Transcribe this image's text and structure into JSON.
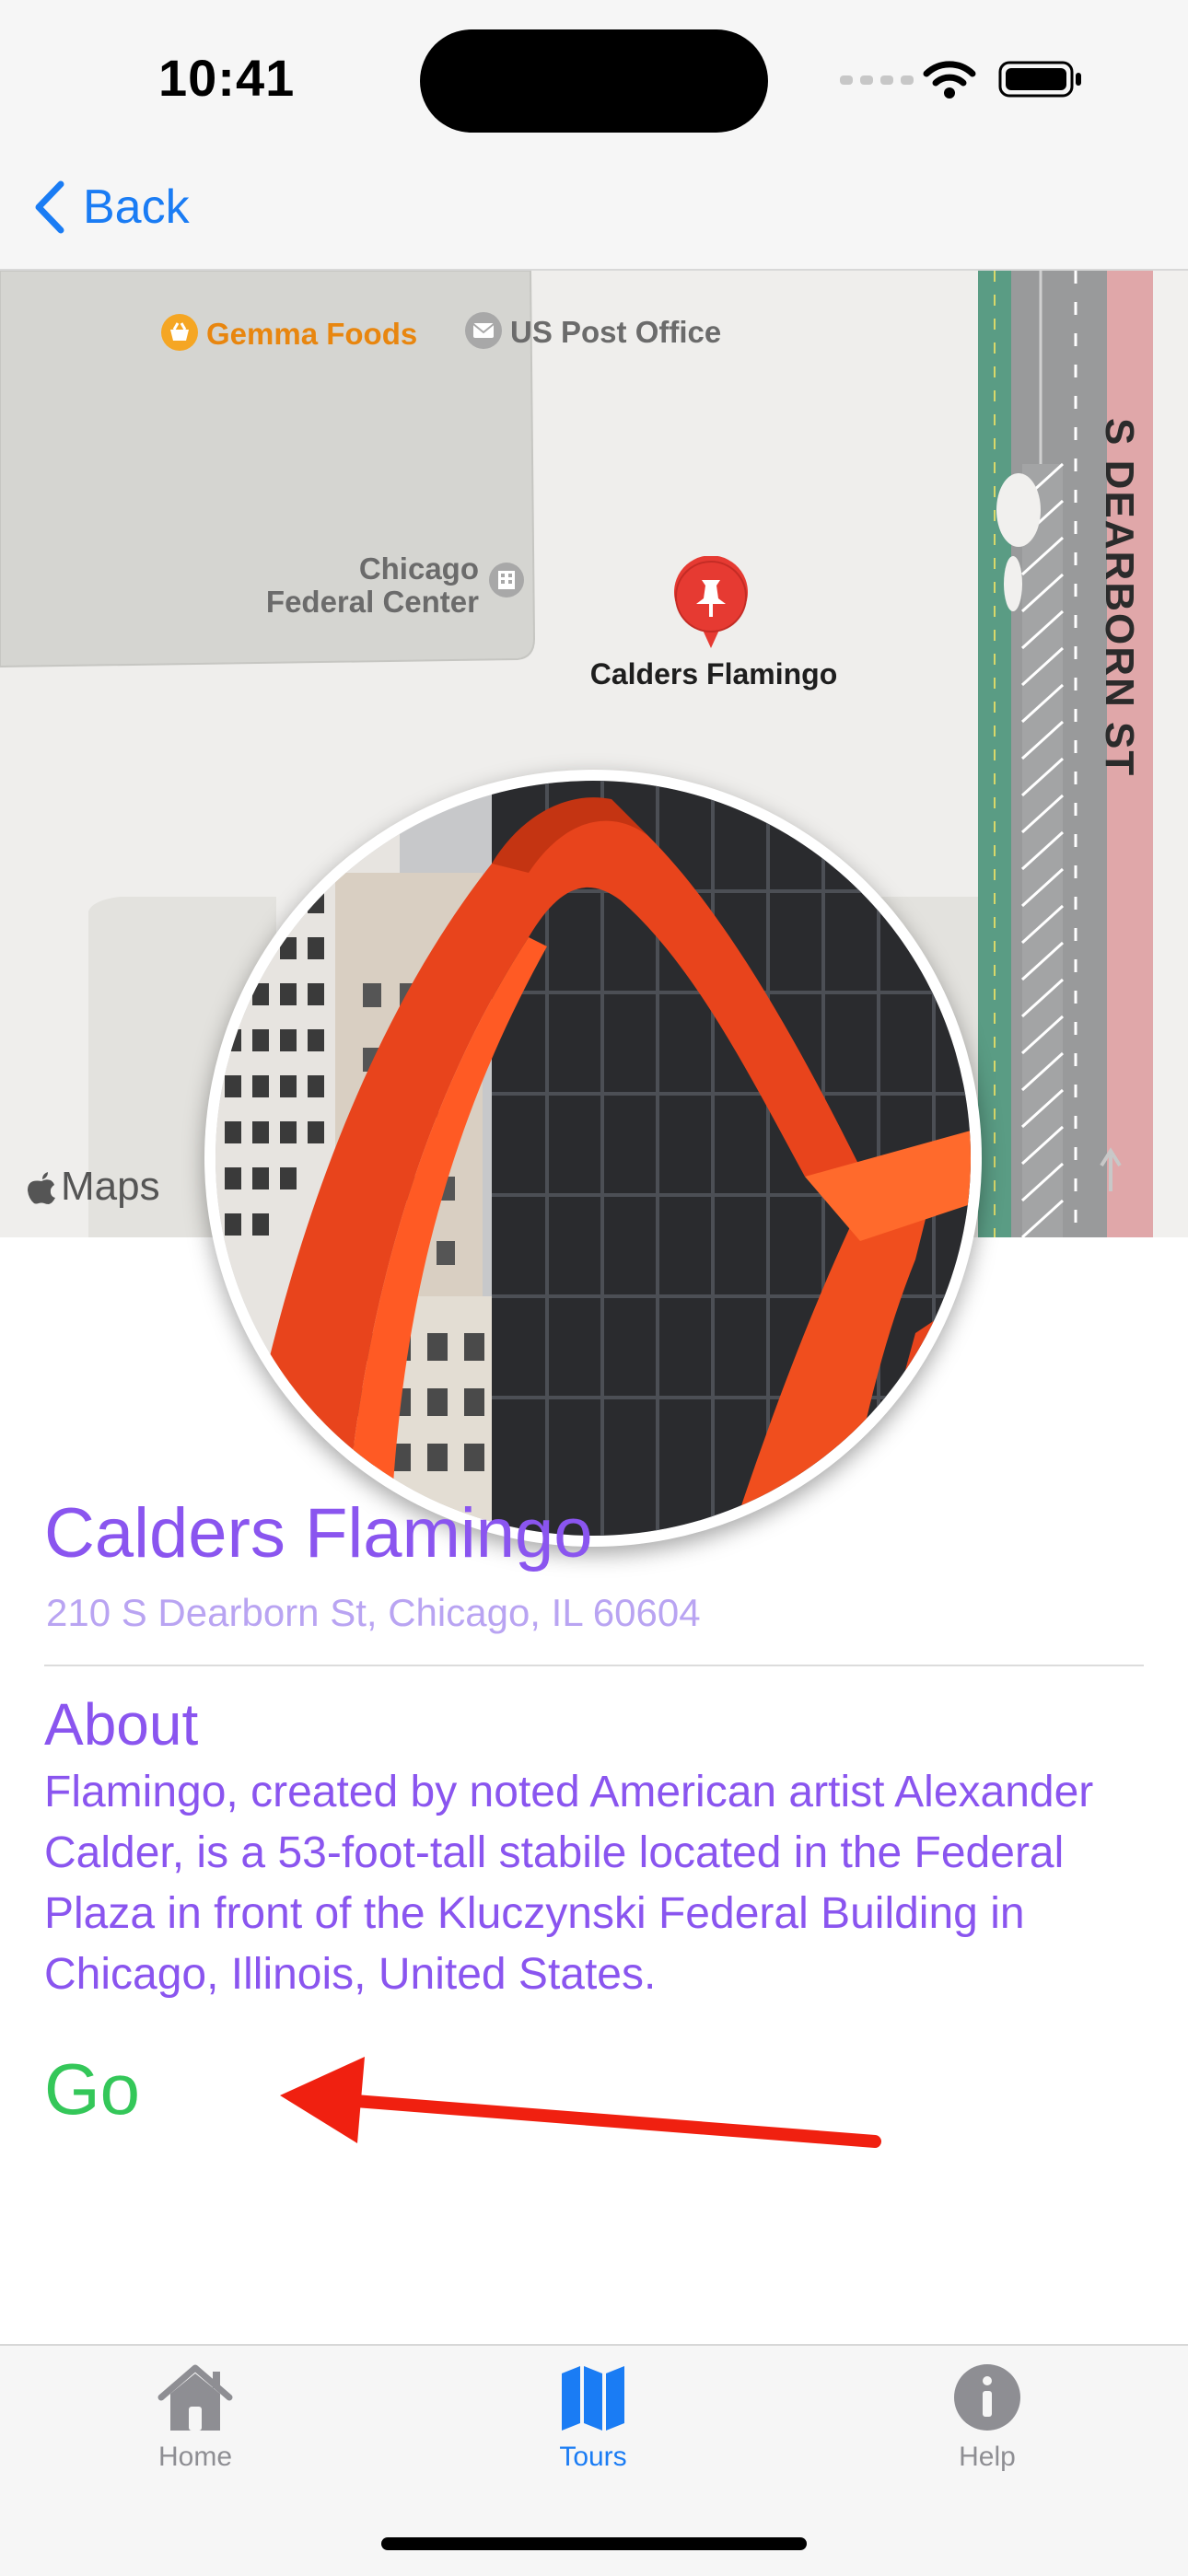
{
  "status_bar": {
    "time": "10:41"
  },
  "nav": {
    "back_label": "Back"
  },
  "map": {
    "poi_food": "Gemma Foods",
    "poi_post": "US Post Office",
    "poi_federal_center": "Chicago\nFederal Center",
    "pin_label": "Calders Flamingo",
    "street_label": "S DEARBORN ST",
    "attribution": "Maps"
  },
  "detail": {
    "title": "Calders Flamingo",
    "address": "210 S Dearborn St, Chicago, IL 60604",
    "about_heading": "About",
    "about_text": "Flamingo, created by noted American artist Alexander Calder, is a 53-foot-tall stabile located in the Federal Plaza in front of the Kluczynski Federal Building in Chicago, Illinois, United States.",
    "go_label": "Go"
  },
  "tabs": [
    {
      "label": "Home",
      "icon": "house-icon",
      "selected": false
    },
    {
      "label": "Tours",
      "icon": "map-icon",
      "selected": true
    },
    {
      "label": "Help",
      "icon": "info-icon",
      "selected": false
    }
  ],
  "colors": {
    "accent": "#8a55ef",
    "go": "#34c759",
    "tab_selected": "#1a7cf4",
    "tab_unselected": "#8e8e93",
    "annotation_arrow": "#f02010"
  }
}
